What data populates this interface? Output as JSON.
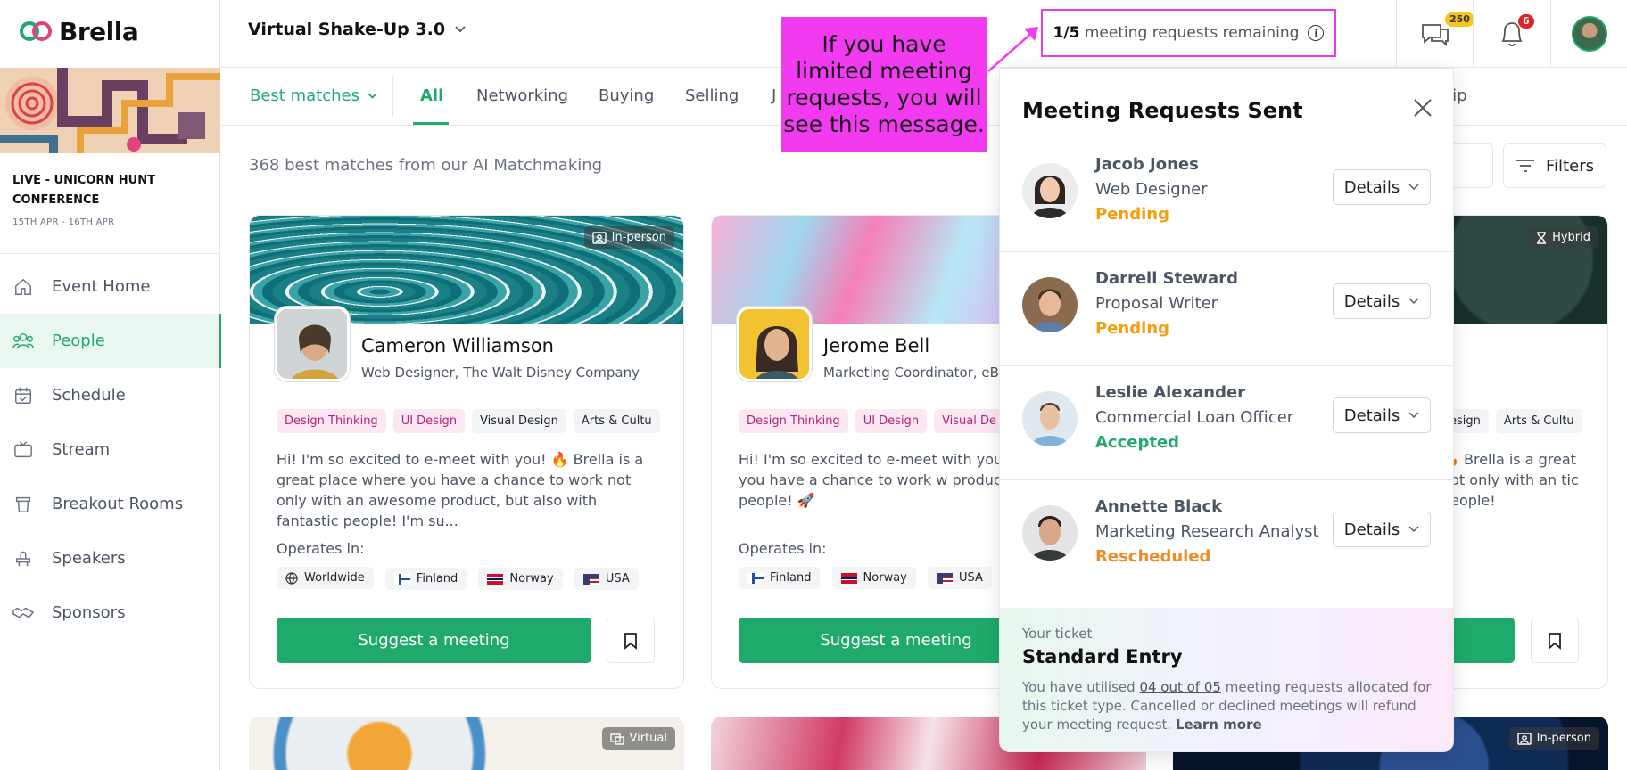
{
  "app": {
    "logo_text": "Brella"
  },
  "sidebar": {
    "event_name": "LIVE - UNICORN HUNT CONFERENCE",
    "event_dates": "15TH APR - 16TH APR",
    "items": [
      {
        "label": "Event Home",
        "icon": "home-icon"
      },
      {
        "label": "People",
        "icon": "people-icon",
        "active": true
      },
      {
        "label": "Schedule",
        "icon": "calendar-icon"
      },
      {
        "label": "Stream",
        "icon": "tv-icon"
      },
      {
        "label": "Breakout Rooms",
        "icon": "cup-icon"
      },
      {
        "label": "Speakers",
        "icon": "speaker-icon"
      },
      {
        "label": "Sponsors",
        "icon": "handshake-icon"
      }
    ]
  },
  "topbar": {
    "event_select": "Virtual Shake-Up 3.0",
    "requests_count": "1/5",
    "requests_text": "meeting requests remaining",
    "chat_badge": "250",
    "notif_badge": "6"
  },
  "callout": {
    "text": "If you have limited meeting requests, you will see this message."
  },
  "tabs": {
    "sort_label": "Best matches",
    "items": [
      "All",
      "Networking",
      "Buying",
      "Selling",
      "J"
    ],
    "active": "All",
    "overflow_label": "rship"
  },
  "main": {
    "count_text": "368 best matches from our AI Matchmaking",
    "filters_label": "Filters"
  },
  "cards": [
    {
      "mode": "In-person",
      "name": "Cameron Williamson",
      "role": "Web Designer, The Walt Disney Company",
      "tags": [
        "Design Thinking",
        "UI Design",
        "Visual Design",
        "Arts & Cultu"
      ],
      "bio": "Hi! I'm so excited to e-meet with you! 🔥 Brella is a great place where you have a chance to work not only with an awesome product, but also with fantastic people! I'm su...",
      "operates_label": "Operates in:",
      "locations": [
        "Worldwide",
        "Finland",
        "Norway",
        "USA"
      ],
      "cta": "Suggest a meeting"
    },
    {
      "mode": "",
      "name": "Jerome Bell",
      "role": "Marketing Coordinator, eBay",
      "tags": [
        "Design Thinking",
        "UI Design",
        "Visual De"
      ],
      "bio": "Hi! I'm so excited to e-meet with you! 🔥 place where you have a chance to work w product and fantastic people! 🚀",
      "operates_label": "Operates in:",
      "locations": [
        "Finland",
        "Norway",
        "USA"
      ],
      "cta": "Suggest a meeting"
    },
    {
      "mode": "Hybrid",
      "tags": [
        "esign",
        "Arts & Cultu"
      ],
      "bio": "🔥 Brella is a great not only with an tic people!"
    }
  ],
  "bottom_cards": [
    "Virtual",
    "",
    "In-person"
  ],
  "panel": {
    "title": "Meeting Requests Sent",
    "details_label": "Details",
    "requests": [
      {
        "name": "Jacob Jones",
        "role": "Web Designer",
        "status": "Pending",
        "status_color": "#f59e0b"
      },
      {
        "name": "Darrell Steward",
        "role": "Proposal Writer",
        "status": "Pending",
        "status_color": "#f59e0b"
      },
      {
        "name": "Leslie Alexander",
        "role": "Commercial Loan Officer",
        "status": "Accepted",
        "status_color": "#1faa6b"
      },
      {
        "name": "Annette Black",
        "role": "Marketing Research Analyst",
        "status": "Rescheduled",
        "status_color": "#f08a24"
      }
    ],
    "ticket": {
      "label": "Your ticket",
      "name": "Standard Entry",
      "text_before": "You have utilised",
      "usage": "04 out of 05",
      "text_after": "meeting requests allocated for this ticket type. Cancelled or declined meetings will refund your meeting request.",
      "learn_more": "Learn more"
    }
  },
  "colors": {
    "brand_green": "#1faa6b",
    "callout_pink": "#f23af0",
    "pending": "#f59e0b"
  }
}
